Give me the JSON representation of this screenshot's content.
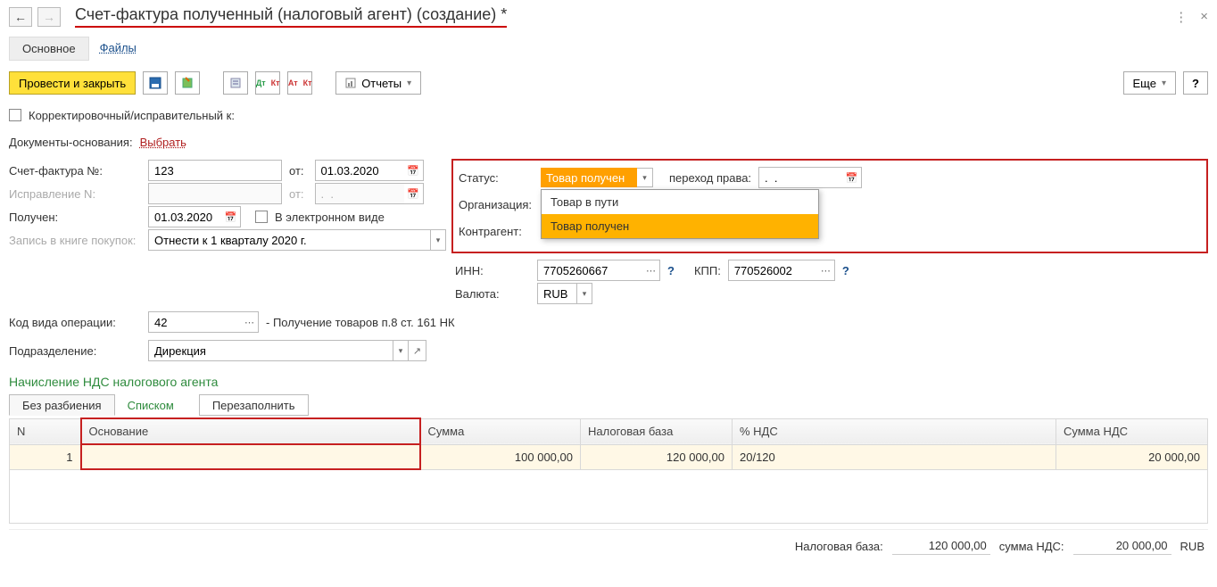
{
  "title": "Счет-фактура полученный (налоговый агент) (создание) *",
  "topbar": {
    "menu_icon": "⋮",
    "close_icon": "×"
  },
  "tabs": {
    "main": "Основное",
    "files": "Файлы"
  },
  "toolbar": {
    "post_close": "Провести и закрыть",
    "reports": "Отчеты",
    "more": "Еще",
    "help": "?"
  },
  "correction": {
    "label": "Корректировочный/исправительный к:"
  },
  "basis_docs": {
    "label": "Документы-основания:",
    "select": "Выбрать"
  },
  "invoice": {
    "no_label": "Счет-фактура №:",
    "no_value": "123",
    "from_label": "от:",
    "from_value": "01.03.2020"
  },
  "fix": {
    "label": "Исправление N:",
    "from_label": "от:",
    "date_placeholder": ".  ."
  },
  "received": {
    "label": "Получен:",
    "value": "01.03.2020",
    "electronic_label": "В электронном виде"
  },
  "book": {
    "label": "Запись в книге покупок:",
    "value": "Отнести к 1 кварталу 2020 г."
  },
  "status": {
    "label": "Статус:",
    "value": "Товар получен",
    "options": [
      "Товар в пути",
      "Товар получен"
    ],
    "transfer_label": "переход права:",
    "transfer_value": ".  ."
  },
  "org_label": "Организация:",
  "counterparty_label": "Контрагент:",
  "inn": {
    "label": "ИНН:",
    "value": "7705260667"
  },
  "kpp": {
    "label": "КПП:",
    "value": "770526002"
  },
  "currency": {
    "label": "Валюта:",
    "value": "RUB"
  },
  "opcode": {
    "label": "Код вида операции:",
    "value": "42",
    "desc": "- Получение товаров п.8 ст. 161 НК"
  },
  "division": {
    "label": "Подразделение:",
    "value": "Дирекция"
  },
  "section_title": "Начисление НДС налогового агента",
  "subtabs": {
    "split": "Без разбиения",
    "list": "Списком",
    "refill": "Перезаполнить"
  },
  "table": {
    "headers": {
      "n": "N",
      "basis": "Основание",
      "sum": "Сумма",
      "tax_base": "Налоговая база",
      "rate": "% НДС",
      "vat": "Сумма НДС"
    },
    "row": {
      "n": "1",
      "basis": "",
      "sum": "100 000,00",
      "tax_base": "120 000,00",
      "rate": "20/120",
      "vat": "20 000,00"
    }
  },
  "footer": {
    "tax_base_label": "Налоговая база:",
    "tax_base_value": "120 000,00",
    "vat_label": "сумма НДС:",
    "vat_value": "20 000,00",
    "currency": "RUB"
  }
}
